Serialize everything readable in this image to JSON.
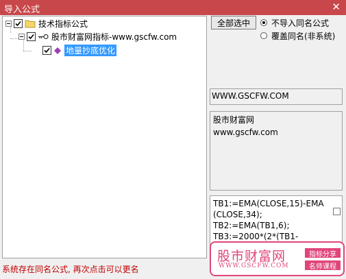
{
  "window": {
    "title": "导入公式",
    "close_glyph": "✕"
  },
  "tree": {
    "root": {
      "label": "技术指标公式"
    },
    "child": {
      "label": "股市财富网指标-www.gscfw.com"
    },
    "leaf": {
      "label": "地量抄底优化"
    }
  },
  "actions": {
    "select_all_label": "全部选中",
    "radio_options": [
      {
        "label": "不导入同名公式",
        "selected": true
      },
      {
        "label": "覆盖同名(非系统)",
        "selected": false
      }
    ]
  },
  "info": {
    "url": "WWW.GSCFW.COM",
    "desc_line1": "股市财富网",
    "desc_line2": "www.gscfw.com"
  },
  "code": {
    "line1": "TB1:=EMA(CLOSE,15)-EMA",
    "line2": "(CLOSE,34);",
    "line3": "TB2:=EMA(TB1,6);",
    "line4": "TB3:=2000*(2*(TB1-"
  },
  "status": {
    "text": "系统存在同名公式, 再次点击可以更名"
  },
  "watermark": {
    "brand_cn": "股市财富网",
    "brand_en": "WWW.GSCFW.COM",
    "badge1": "指标分享",
    "badge2": "名师课程",
    "accent_color": "#e0447a"
  },
  "colors": {
    "titlebar": "#c8474a",
    "selection": "#3399ff",
    "status_text": "#c00000"
  }
}
